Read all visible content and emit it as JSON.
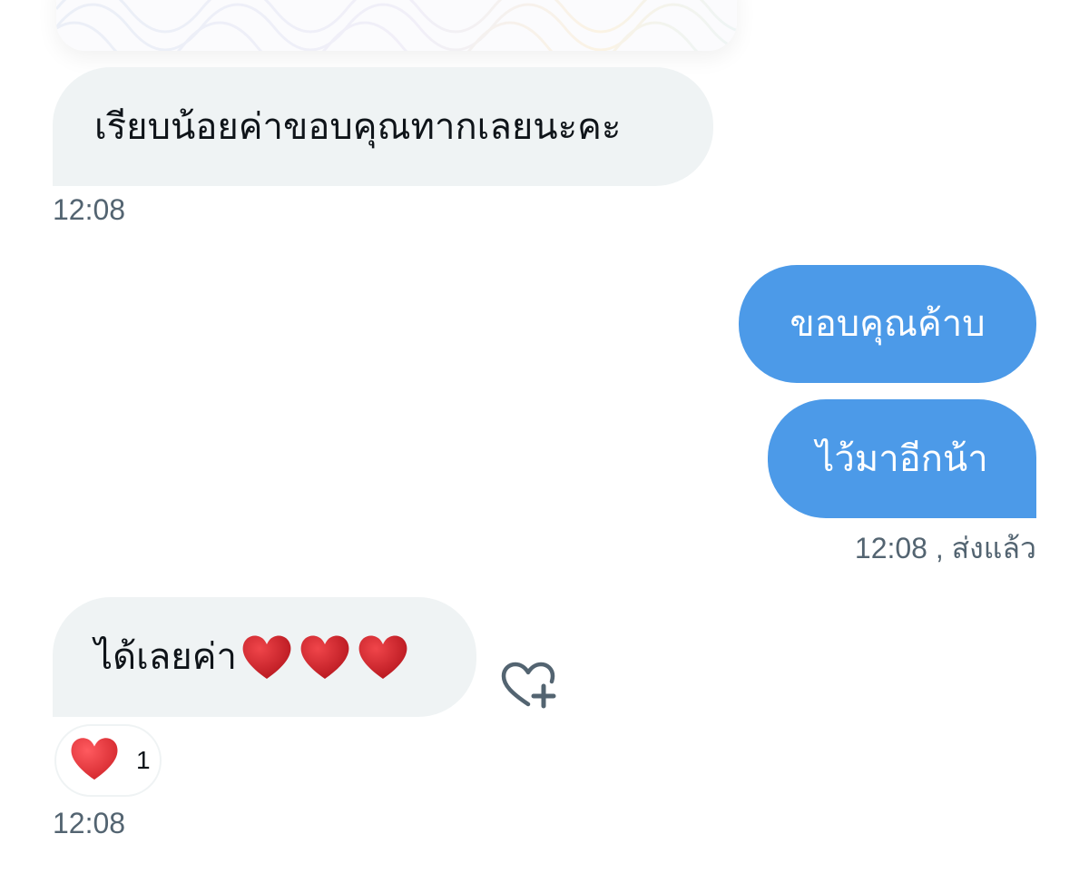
{
  "messages": [
    {
      "direction": "incoming",
      "text": "เรียบน้อยค่าขอบคุณทากเลยนะคะ"
    },
    {
      "direction": "outgoing",
      "text": "ขอบคุณค้าบ"
    },
    {
      "direction": "outgoing",
      "text": "ไว้มาอีกน้า"
    },
    {
      "direction": "incoming",
      "text": "ได้เลยค่า",
      "emoji": [
        "heart",
        "heart",
        "heart"
      ]
    }
  ],
  "timestamps": {
    "first": "12:08",
    "sent": "12:08 , ส่งแล้ว",
    "last": "12:08"
  },
  "reaction": {
    "emoji": "heart",
    "count": "1"
  },
  "colors": {
    "incoming_bubble": "#eff3f4",
    "outgoing_bubble": "#4c9ae8",
    "timestamp_text": "#536471",
    "heart": "#d0242a"
  },
  "icons": {
    "add_reaction": "heart-plus-icon"
  }
}
